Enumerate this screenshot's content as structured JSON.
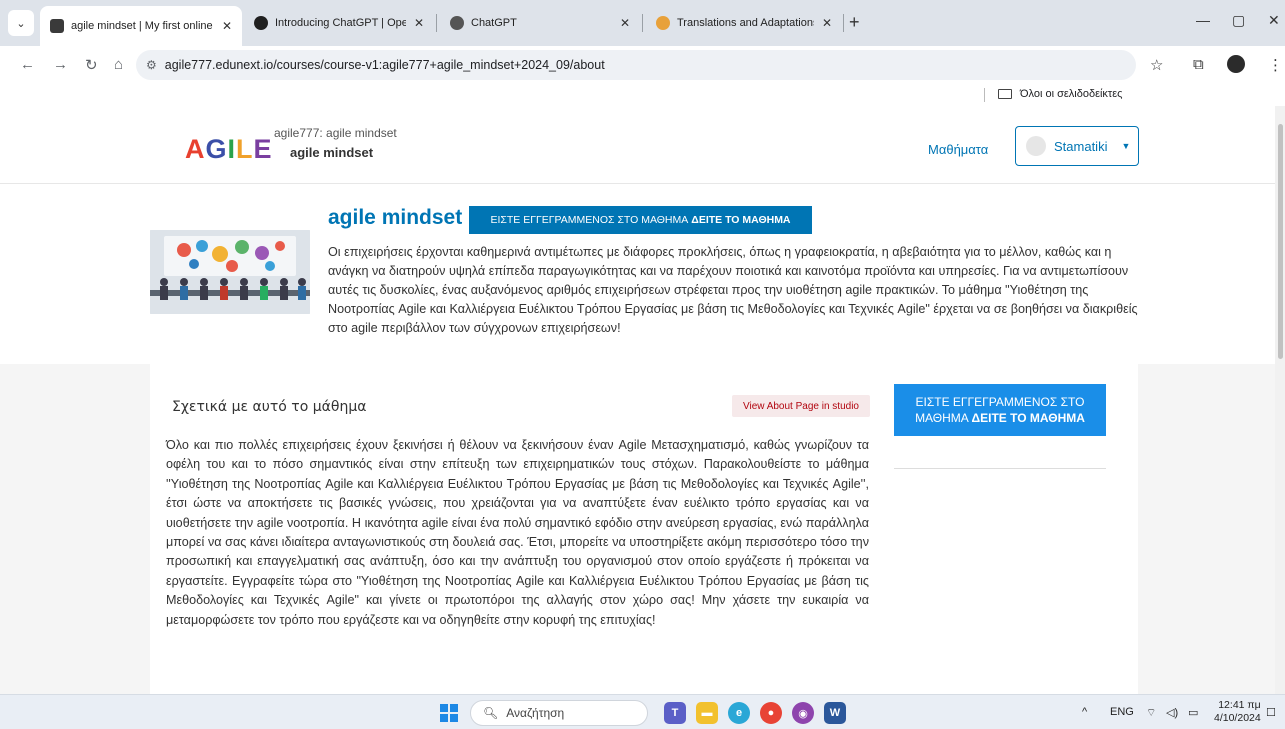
{
  "browser": {
    "tabs": [
      {
        "title": "agile mindset | My first online p",
        "active": true,
        "color": "#3a3a3a"
      },
      {
        "title": "Introducing ChatGPT | OpenAI",
        "active": false,
        "color": "#202020"
      },
      {
        "title": "ChatGPT",
        "active": false,
        "color": "#555555"
      },
      {
        "title": "Translations and Adaptations -",
        "active": false,
        "color": "#e8a13a"
      }
    ],
    "url": "agile777.edunext.io/courses/course-v1:agile777+agile_mindset+2024_09/about",
    "bookmarks_all": "Όλοι οι σελιδοδείκτες"
  },
  "site": {
    "logo_letters": [
      {
        "ch": "A",
        "color": "#e8402f"
      },
      {
        "ch": "G",
        "color": "#3b4fa8"
      },
      {
        "ch": "I",
        "color": "#2aa24b"
      },
      {
        "ch": "L",
        "color": "#f0a12b"
      },
      {
        "ch": "E",
        "color": "#7a3fa0"
      }
    ],
    "course_org": "agile777: agile mindset",
    "course_name": "agile mindset",
    "courses_link": "Μαθήματα",
    "username": "Stamatiki"
  },
  "hero": {
    "title": "agile mindset",
    "enroll_prefix": "ΕΙΣΤΕ ΕΓΓΕΓΡΑΜΜΕΝΟΣ ΣΤΟ ΜΑΘΗΜΑ",
    "enroll_action": "ΔΕΙΤΕ ΤΟ ΜΑΘΗΜΑ",
    "description": "Οι επιχειρήσεις έρχονται καθημερινά αντιμέτωπες με διάφορες προκλήσεις, όπως η γραφειοκρατία, η αβεβαιότητα για το μέλλον, καθώς και η ανάγκη να διατηρούν υψηλά επίπεδα παραγωγικότητας και να παρέχουν ποιοτικά και καινοτόμα προϊόντα και υπηρεσίες. Για να αντιμετωπίσουν αυτές τις δυσκολίες, ένας αυξανόμενος αριθμός επιχειρήσεων στρέφεται προς την υιοθέτηση agile πρακτικών. Το μάθημα \"Υιοθέτηση της Νοοτροπίας Agile και Καλλιέργεια Ευέλικτου Τρόπου Εργασίας με βάση τις Μεθοδολογίες και Τεχνικές Agile\" έρχεται να σε βοηθήσει να διακριθείς στο agile περιβάλλον των σύγχρονων επιχειρήσεων!"
  },
  "about": {
    "title": "Σχετικά με αυτό το μάθημα",
    "studio_button": "View About Page in studio",
    "text": "Όλο και πιο πολλές επιχειρήσεις έχουν ξεκινήσει ή θέλουν να ξεκινήσουν έναν Agile Μετασχηματισμό, καθώς γνωρίζουν τα οφέλη του και το πόσο σημαντικός είναι στην επίτευξη των επιχειρηματικών τους στόχων. Παρακολουθείστε το μάθημα ''Υιοθέτηση της Νοοτροπίας Agile και Καλλιέργεια Ευέλικτου Τρόπου Εργασίας με βάση τις Μεθοδολογίες και Τεχνικές Agile'', έτσι ώστε να αποκτήσετε τις βασικές γνώσεις, που χρειάζονται για να αναπτύξετε έναν ευέλικτο τρόπο εργασίας και να υιοθετήσετε την agile νοοτροπία. Η ικανότητα agile είναι ένα πολύ σημαντικό εφόδιο στην ανεύρεση εργασίας, ενώ παράλληλα μπορεί να σας κάνει ιδιαίτερα ανταγωνιστικούς στη δουλειά σας. Έτσι, μπορείτε να υποστηρίξετε ακόμη περισσότερο τόσο την προσωπική και επαγγελματική σας ανάπτυξη, όσο και την ανάπτυξη του οργανισμού στον οποίο εργάζεστε ή πρόκειται να εργαστείτε. Εγγραφείτε τώρα στο \"Υιοθέτηση της Νοοτροπίας Agile και Καλλιέργεια Ευέλικτου Τρόπου Εργασίας με βάση τις Μεθοδολογίες και Τεχνικές Agile\" και γίνετε οι πρωτοπόροι της αλλαγής στον χώρο σας! Μην χάσετε την ευκαιρία να μεταμορφώσετε τον τρόπο που εργάζεστε και να οδηγηθείτε στην κορυφή της επιτυχίας!",
    "side_enroll_prefix": "ΕΙΣΤΕ ΕΓΓΕΓΡΑΜΜΕΝΟΣ ΣΤΟ ΜΑΘΗΜΑ",
    "side_enroll_action": "ΔΕΙΤΕ ΤΟ ΜΑΘΗΜΑ"
  },
  "taskbar": {
    "search_placeholder": "Αναζήτηση",
    "lang": "ENG",
    "time": "12:41 πμ",
    "date": "4/10/2024"
  },
  "colors": {
    "accent": "#0075b4",
    "side_button": "#1a8ee8",
    "studio_text": "#b20610"
  }
}
